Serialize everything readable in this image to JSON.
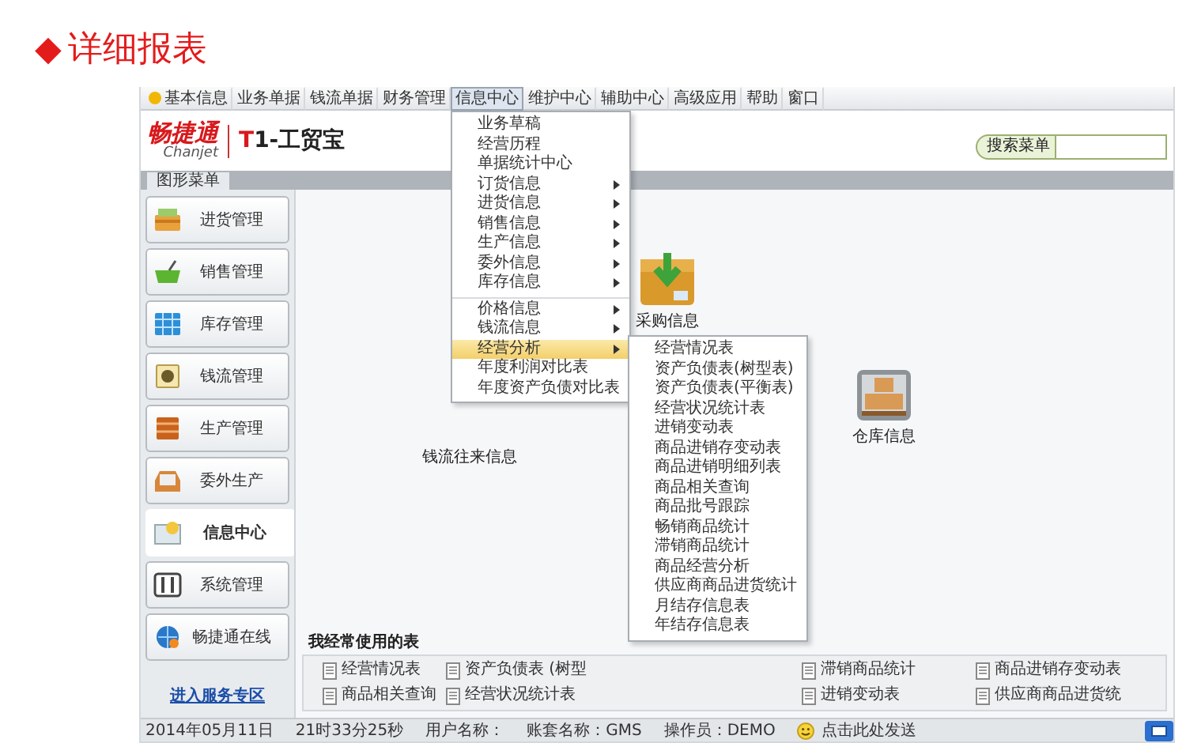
{
  "heading": {
    "marker": "◆",
    "text": "详细报表"
  },
  "menu_bar": [
    {
      "label": "基本信息",
      "selected": false
    },
    {
      "label": "业务单据",
      "selected": false
    },
    {
      "label": "钱流单据",
      "selected": false
    },
    {
      "label": "财务管理",
      "selected": false
    },
    {
      "label": "信息中心",
      "selected": true
    },
    {
      "label": "维护中心",
      "selected": false
    },
    {
      "label": "辅助中心",
      "selected": false
    },
    {
      "label": "高级应用",
      "selected": false
    },
    {
      "label": "帮助",
      "selected": false
    },
    {
      "label": "窗口",
      "selected": false
    }
  ],
  "logo": {
    "brand": "畅捷通",
    "latin": "Chanjet",
    "product": "T1-工贸宝"
  },
  "search": {
    "label": "搜索菜单"
  },
  "tabs": [
    {
      "label": "图形菜单",
      "selected": true
    }
  ],
  "sidebar": {
    "items": [
      {
        "label": "进货管理",
        "kind": "purchase",
        "selected": false
      },
      {
        "label": "销售管理",
        "kind": "sales",
        "selected": false
      },
      {
        "label": "库存管理",
        "kind": "inventory",
        "selected": false
      },
      {
        "label": "钱流管理",
        "kind": "cash",
        "selected": false
      },
      {
        "label": "生产管理",
        "kind": "production",
        "selected": false
      },
      {
        "label": "委外生产",
        "kind": "outsource",
        "selected": false
      },
      {
        "label": "信息中心",
        "kind": "info",
        "selected": true
      },
      {
        "label": "系统管理",
        "kind": "system",
        "selected": false
      },
      {
        "label": "畅捷通在线",
        "kind": "online",
        "selected": false
      }
    ],
    "link": "进入服务专区"
  },
  "desktop": [
    {
      "label": "采购信息",
      "kind": "purchase"
    },
    {
      "label": "仓库信息",
      "kind": "warehouse"
    },
    {
      "label": "钱流往来信息",
      "kind": "covered"
    }
  ],
  "info_menu": [
    {
      "label": "业务草稿",
      "has_submenu": false,
      "separator_before": false,
      "selected": false
    },
    {
      "label": "经营历程",
      "has_submenu": false,
      "separator_before": false,
      "selected": false
    },
    {
      "label": "单据统计中心",
      "has_submenu": false,
      "separator_before": false,
      "selected": false
    },
    {
      "label": "订货信息",
      "has_submenu": true,
      "separator_before": false,
      "selected": false
    },
    {
      "label": "进货信息",
      "has_submenu": true,
      "separator_before": false,
      "selected": false
    },
    {
      "label": "销售信息",
      "has_submenu": true,
      "separator_before": false,
      "selected": false
    },
    {
      "label": "生产信息",
      "has_submenu": true,
      "separator_before": false,
      "selected": false
    },
    {
      "label": "委外信息",
      "has_submenu": true,
      "separator_before": false,
      "selected": false
    },
    {
      "label": "库存信息",
      "has_submenu": true,
      "separator_before": false,
      "selected": false
    },
    {
      "label": "价格信息",
      "has_submenu": true,
      "separator_before": true,
      "selected": false
    },
    {
      "label": "钱流信息",
      "has_submenu": true,
      "separator_before": false,
      "selected": false
    },
    {
      "label": "经营分析",
      "has_submenu": true,
      "separator_before": false,
      "selected": true
    },
    {
      "label": "年度利润对比表",
      "has_submenu": false,
      "separator_before": false,
      "selected": false
    },
    {
      "label": "年度资产负债对比表",
      "has_submenu": false,
      "separator_before": false,
      "selected": false
    }
  ],
  "submenu": [
    "经营情况表",
    "资产负债表(树型表)",
    "资产负债表(平衡表)",
    "经营状况统计表",
    "进销变动表",
    "商品进销存变动表",
    "商品进销明细列表",
    "商品相关查询",
    "商品批号跟踪",
    "畅销商品统计",
    "滞销商品统计",
    "商品经营分析",
    "供应商商品进货统计",
    "月结存信息表",
    "年结存信息表"
  ],
  "frequent": {
    "title": "我经常使用的表",
    "rows": [
      [
        "经营情况表",
        "资产负债表 (树型",
        null,
        "滞销商品统计",
        "商品进销存变动表"
      ],
      [
        "商品相关查询",
        "经营状况统计表",
        null,
        "进销变动表",
        "供应商商品进货统"
      ]
    ]
  },
  "status_bar": {
    "date": "2014年05月11日",
    "time": "21时33分25秒",
    "user": "用户名称：",
    "account": "账套名称：GMS",
    "operator": "操作员：DEMO",
    "send": "点击此处发送"
  }
}
